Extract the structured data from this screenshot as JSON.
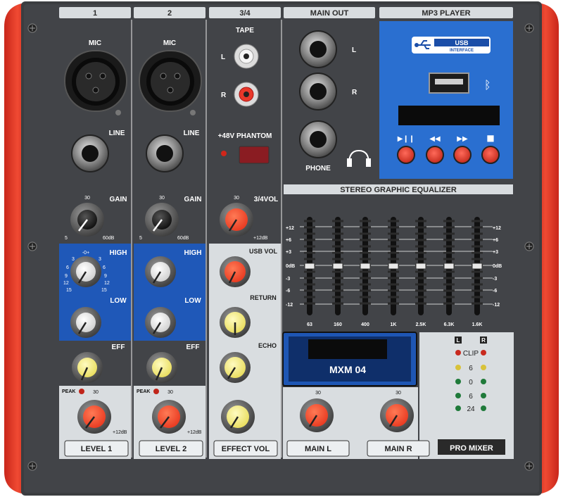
{
  "sections": {
    "ch1": "1",
    "ch2": "2",
    "ch34": "3/4",
    "main_out": "MAIN OUT",
    "mp3": "MP3 PLAYER"
  },
  "channel": {
    "mic": "MIC",
    "line": "LINE",
    "gain": "GAIN",
    "gain_min": "5",
    "gain_mid": "30",
    "gain_max": "60dB",
    "high": "HIGH",
    "low": "LOW",
    "eff": "EFF",
    "peak": "PEAK",
    "level_mid": "30",
    "level_max": "+12dB",
    "eq_ticks": [
      "-0+",
      "3",
      "3",
      "6",
      "6",
      "9",
      "9",
      "12",
      "12",
      "15",
      "15"
    ]
  },
  "ch34": {
    "tape": "TAPE",
    "l": "L",
    "r": "R",
    "phantom": "+48V  PHANTOM",
    "vol": "3/4VOL",
    "usb_vol": "USB VOL",
    "return": "RETURN",
    "echo": "ECHO"
  },
  "main_out": {
    "l": "L",
    "r": "R",
    "phone": "PHONE"
  },
  "mp3": {
    "usb_badge": "USB",
    "usb_interface": "INTERFACE",
    "buttons": [
      "▶❙❙",
      "◀◀",
      "▶▶",
      "■"
    ]
  },
  "eq": {
    "title": "STEREO GRAPHIC EQUALIZER",
    "scale": [
      "+12",
      "+6",
      "+3",
      "0dB",
      "-3",
      "-6",
      "-12"
    ],
    "bands": [
      "63",
      "160",
      "400",
      "1K",
      "2.5K",
      "6.3K",
      "1.6K"
    ]
  },
  "model": "MXM 04",
  "brand": "PRO MIXER",
  "meter": {
    "l": "L",
    "r": "R",
    "labels": [
      "CLIP",
      "6",
      "0",
      "6",
      "24"
    ]
  },
  "bottom": {
    "level1": "LEVEL 1",
    "level2": "LEVEL 2",
    "effect_vol": "EFFECT VOL",
    "main_l": "MAIN L",
    "main_r": "MAIN R"
  }
}
